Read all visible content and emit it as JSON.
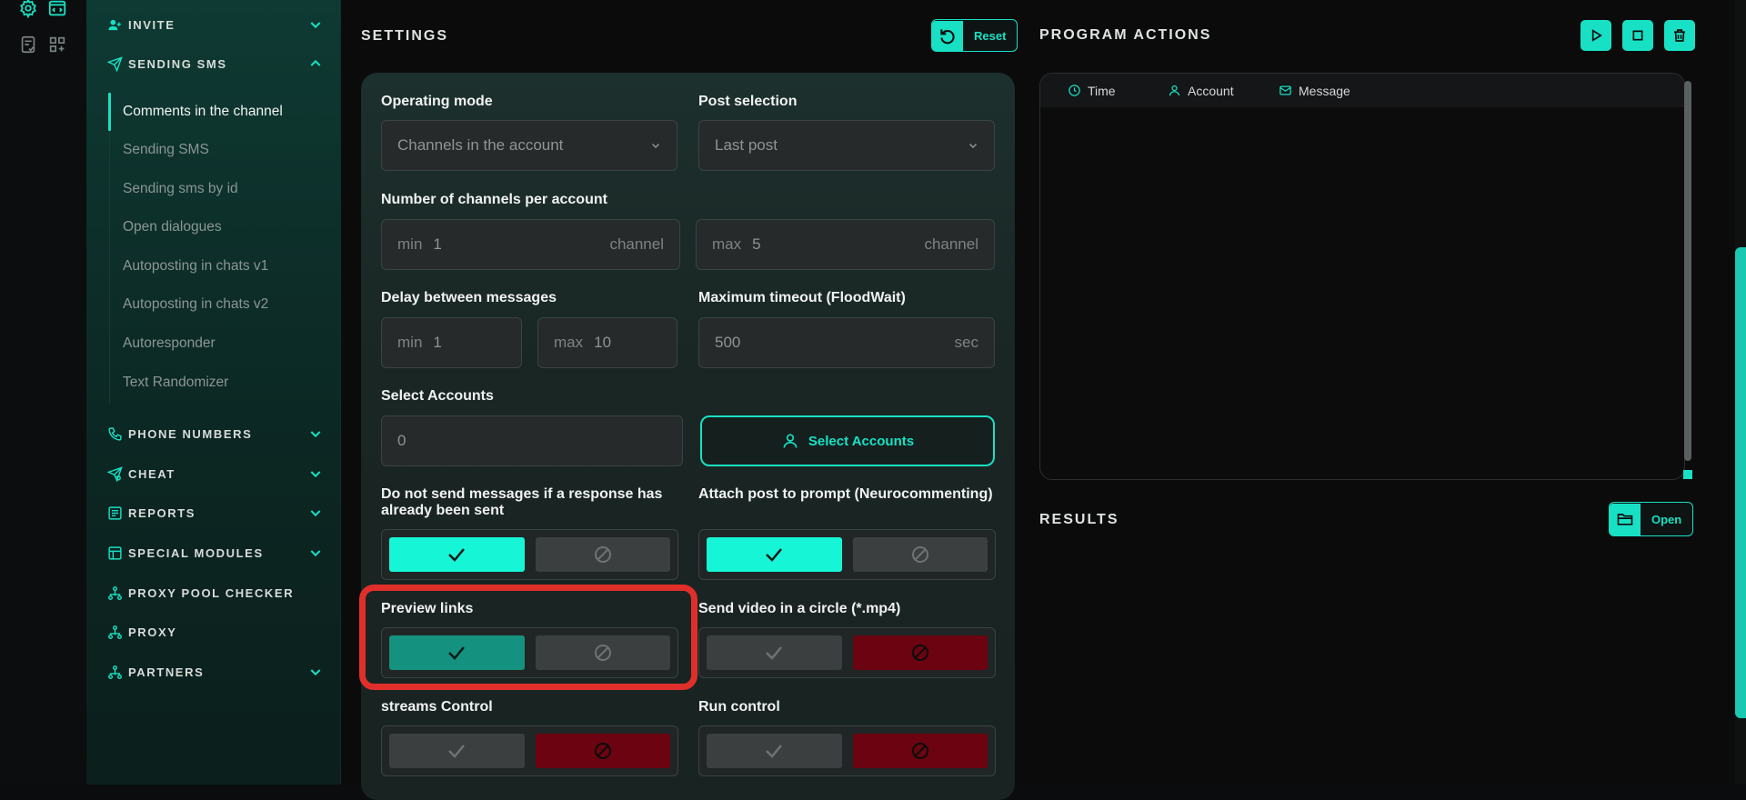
{
  "rail": {
    "icons": [
      "gear-icon",
      "code-icon",
      "notes-icon",
      "grid-icon"
    ]
  },
  "sidebar": {
    "sections": [
      {
        "label": "INVITE",
        "icon": "person-plus-icon",
        "expanded": false
      },
      {
        "label": "SENDING SMS",
        "icon": "send-icon",
        "expanded": true
      },
      {
        "label": "PHONE NUMBERS",
        "icon": "phone-icon",
        "expanded": false
      },
      {
        "label": "CHEAT",
        "icon": "send-icon",
        "expanded": false
      },
      {
        "label": "REPORTS",
        "icon": "report-icon",
        "expanded": false
      },
      {
        "label": "SPECIAL MODULES",
        "icon": "modules-icon",
        "expanded": false
      },
      {
        "label": "PROXY POOL CHECKER",
        "icon": "network-icon",
        "expanded": null
      },
      {
        "label": "PROXY",
        "icon": "network-icon",
        "expanded": null
      },
      {
        "label": "PARTNERS",
        "icon": "network-icon",
        "expanded": false
      }
    ],
    "sms_items": [
      {
        "label": "Comments in the channel",
        "active": true
      },
      {
        "label": "Sending SMS",
        "active": false
      },
      {
        "label": "Sending sms by id",
        "active": false
      },
      {
        "label": "Open dialogues",
        "active": false
      },
      {
        "label": "Autoposting in chats v1",
        "active": false
      },
      {
        "label": "Autoposting in chats v2",
        "active": false
      },
      {
        "label": "Autoresponder",
        "active": false
      },
      {
        "label": "Text Randomizer",
        "active": false
      }
    ]
  },
  "settings": {
    "title": "SETTINGS",
    "reset_label": "Reset",
    "operating_mode": {
      "label": "Operating mode",
      "value": "Channels in the account"
    },
    "post_selection": {
      "label": "Post selection",
      "value": "Last post"
    },
    "channels_per_account": {
      "label": "Number of channels per account",
      "min_prefix": "min",
      "min_value": "1",
      "min_unit": "channel",
      "max_prefix": "max",
      "max_value": "5",
      "max_unit": "channel"
    },
    "delay": {
      "label": "Delay between messages",
      "min_prefix": "min",
      "min_value": "1",
      "max_prefix": "max",
      "max_value": "10"
    },
    "timeout": {
      "label": "Maximum timeout (FloodWait)",
      "value": "500",
      "unit": "sec"
    },
    "accounts": {
      "label": "Select Accounts",
      "value": "0",
      "button": "Select Accounts"
    },
    "no_repeat": {
      "label": "Do not send messages if a response has already been sent",
      "enabled": true
    },
    "attach_post": {
      "label": "Attach post to prompt (Neurocommenting)",
      "enabled": true
    },
    "preview_links": {
      "label": "Preview links",
      "enabled": true
    },
    "video_circle": {
      "label": "Send video in a circle (*.mp4)",
      "enabled": false
    },
    "streams_control": {
      "label": "streams Control",
      "enabled": false
    },
    "run_control": {
      "label": "Run control",
      "enabled": false
    }
  },
  "program_actions": {
    "title": "PROGRAM ACTIONS",
    "columns": [
      {
        "label": "Time",
        "icon": "clock-icon"
      },
      {
        "label": "Account",
        "icon": "user-icon"
      },
      {
        "label": "Message",
        "icon": "mail-icon"
      }
    ]
  },
  "results": {
    "title": "RESULTS",
    "open_label": "Open"
  },
  "colors": {
    "accent": "#18e0c4",
    "danger": "#6b0410",
    "highlight": "#e02f2a"
  }
}
